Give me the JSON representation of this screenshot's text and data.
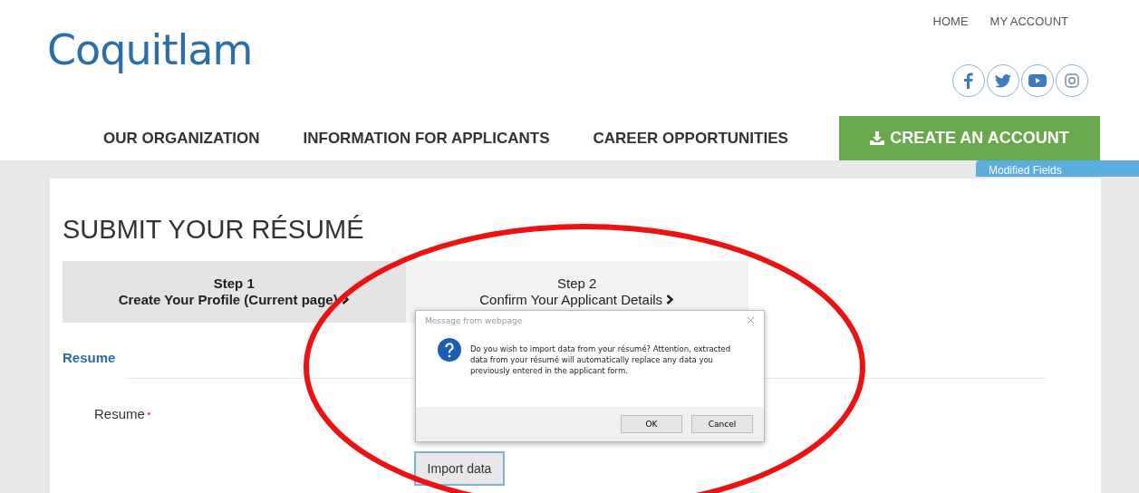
{
  "logo": {
    "text": "Coquitlam"
  },
  "top_links": [
    {
      "label": "HOME"
    },
    {
      "label": "MY ACCOUNT"
    }
  ],
  "social": [
    {
      "kind": "facebook"
    },
    {
      "kind": "twitter"
    },
    {
      "kind": "youtube"
    },
    {
      "kind": "instagram"
    }
  ],
  "nav": [
    {
      "label": "OUR ORGANIZATION"
    },
    {
      "label": "INFORMATION FOR APPLICANTS"
    },
    {
      "label": "CAREER OPPORTUNITIES"
    }
  ],
  "create_account": {
    "label": "CREATE AN ACCOUNT"
  },
  "side_tab": {
    "label": "Modified Fields"
  },
  "page_title": "SUBMIT YOUR RÉSUMÉ",
  "steps": [
    {
      "step": "Step 1",
      "label": "Create Your Profile (Current page)",
      "selected": true
    },
    {
      "step": "Step 2",
      "label": "Confirm Your Applicant Details",
      "selected": false
    }
  ],
  "section": {
    "title": "Resume"
  },
  "field": {
    "label": "Resume",
    "required_mark": "•"
  },
  "import_button": {
    "label": "Import data"
  },
  "dialog": {
    "title": "Message from webpage",
    "message": "Do you wish to import data from your résumé? Attention, extracted data from your résumé will automatically replace any data you previously entered in the applicant form.",
    "buttons": [
      {
        "label": "OK"
      },
      {
        "label": "Cancel"
      }
    ]
  }
}
